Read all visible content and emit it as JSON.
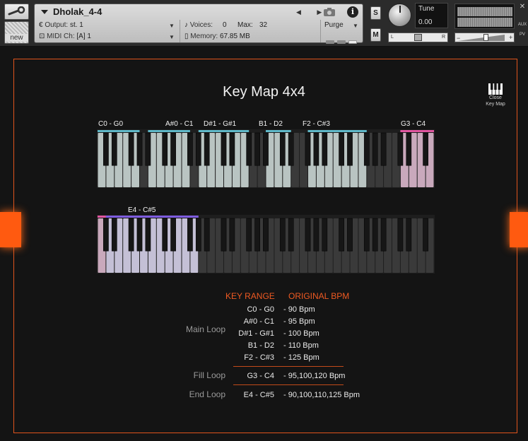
{
  "header": {
    "instrument_name": "Dholak_4-4",
    "output_label": "Output:",
    "output_value": "st. 1",
    "midi_label": "MIDI Ch:",
    "midi_value": "[A]  1",
    "voices_label": "Voices:",
    "voices_value": "0",
    "max_label": "Max:",
    "max_value": "32",
    "memory_label": "Memory:",
    "memory_value": "67.85 MB",
    "purge_label": "Purge",
    "new_label": "new",
    "s_label": "S",
    "m_label": "M",
    "tune_label": "Tune",
    "tune_value": "0.00",
    "pan_left": "L",
    "pan_right": "R",
    "aux_label": "AUX",
    "pv_label": "PV",
    "vol_minus": "−",
    "vol_plus": "+"
  },
  "main": {
    "title": "Key Map 4x4",
    "close_line1": "Close",
    "close_line2": "Key Map",
    "keyboard1_labels": [
      "C0 - G0",
      "A#0 - C1",
      "D#1 - G#1",
      "B1 - D2",
      "F2 - C#3",
      "G3 - C4"
    ],
    "keyboard2_labels": [
      "E4 - C#5"
    ],
    "table": {
      "col_range": "KEY RANGE",
      "col_bpm": "ORIGINAL BPM",
      "main_loop": "Main Loop",
      "fill_loop": "Fill Loop",
      "end_loop": "End Loop",
      "main_rows": [
        {
          "range": "C0 - G0",
          "bpm": "- 90 Bpm"
        },
        {
          "range": "A#0 - C1",
          "bpm": "- 95 Bpm"
        },
        {
          "range": "D#1 - G#1",
          "bpm": "- 100 Bpm"
        },
        {
          "range": "B1 - D2",
          "bpm": "- 110 Bpm"
        },
        {
          "range": "F2 - C#3",
          "bpm": "- 125 Bpm"
        }
      ],
      "fill_row": {
        "range": "G3 - C4",
        "bpm": "- 95,100,120 Bpm"
      },
      "end_row": {
        "range": "E4 - C#5",
        "bpm": "- 90,100,110,125 Bpm"
      }
    }
  },
  "colors": {
    "accent": "#ef5a22",
    "main_zone": "#5fb8c8",
    "fill_zone": "#e0559f",
    "end_zone": "#7e5ce0"
  }
}
